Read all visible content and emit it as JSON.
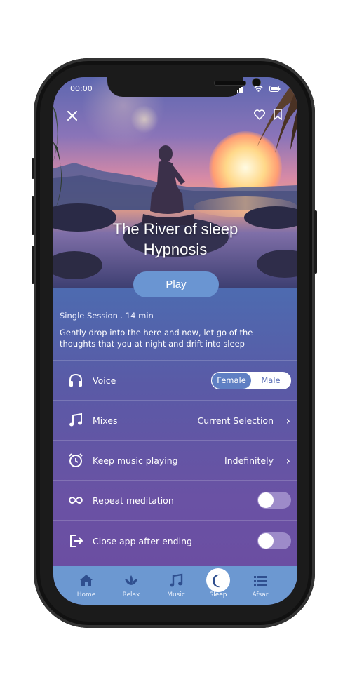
{
  "status_bar": {
    "time": "00:00"
  },
  "hero": {
    "title_line1": "The River of sleep",
    "title_line2": "Hypnosis",
    "play_label": "Play"
  },
  "session": {
    "meta": "Single Session . 14 min",
    "description": "Gently drop into the here and now, let go of the thoughts that you at night and drift into sleep"
  },
  "settings": {
    "voice": {
      "label": "Voice",
      "options": [
        "Female",
        "Male"
      ],
      "selected": "Female"
    },
    "mixes": {
      "label": "Mixes",
      "value": "Current Selection"
    },
    "keep_music": {
      "label": "Keep music playing",
      "value": "Indefinitely"
    },
    "repeat": {
      "label": "Repeat meditation",
      "enabled": false
    },
    "close_app": {
      "label": "Close app after ending",
      "enabled": false
    }
  },
  "tabs": [
    {
      "label": "Home",
      "icon": "home-icon"
    },
    {
      "label": "Relax",
      "icon": "lotus-icon"
    },
    {
      "label": "Music",
      "icon": "music-note-icon"
    },
    {
      "label": "Sleep",
      "icon": "moon-icon",
      "active": true
    },
    {
      "label": "Afsar",
      "icon": "list-icon"
    }
  ],
  "colors": {
    "accent": "#6a95d2",
    "panel_top": "#4d6bb0",
    "panel_bottom": "#6b4ea2",
    "tabbar": "#6c98d1"
  }
}
